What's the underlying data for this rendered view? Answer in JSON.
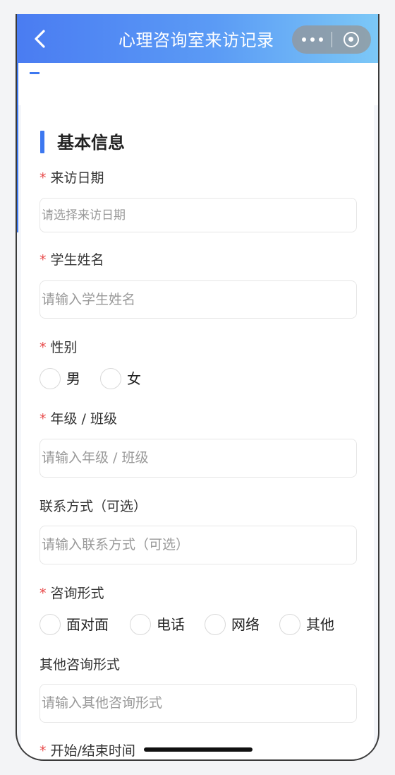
{
  "navbar": {
    "title": "心理咨询室来访记录",
    "back_icon": "chevron-left-icon",
    "more_icon": "more-dots-icon",
    "close_icon": "target-circle-icon",
    "gradient": [
      "#4a7cf2",
      "#7cc8f7"
    ]
  },
  "section": {
    "title": "基本信息",
    "accent": "#3d78f0"
  },
  "required_mark": "*",
  "fields": {
    "visit_date": {
      "label": "来访日期",
      "placeholder": "请选择来访日期"
    },
    "student_name": {
      "label": "学生姓名",
      "placeholder": "请输入学生姓名"
    },
    "gender": {
      "label": "性别",
      "options": [
        "男",
        "女"
      ]
    },
    "grade_class": {
      "label": "年级 / 班级",
      "placeholder": "请输入年级 / 班级"
    },
    "contact": {
      "label": "联系方式（可选）",
      "placeholder": "请输入联系方式（可选）"
    },
    "consult_form": {
      "label": "咨询形式",
      "options": [
        "面对面",
        "电话",
        "网络",
        "其他"
      ]
    },
    "other_form": {
      "label": "其他咨询形式",
      "placeholder": "请输入其他咨询形式"
    },
    "start_end_time": {
      "label": "开始/结束时间"
    }
  },
  "colors": {
    "required": "#e84a4a",
    "placeholder": "#999999",
    "border": "#e6e6e6"
  }
}
